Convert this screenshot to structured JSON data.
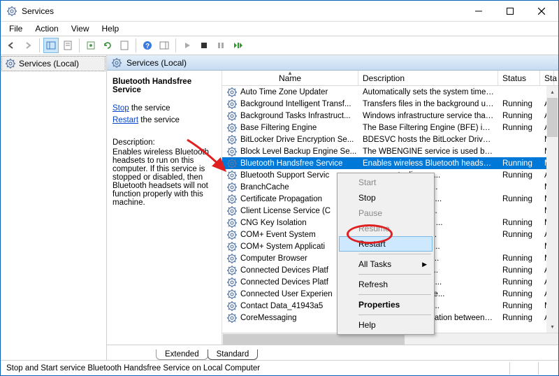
{
  "window": {
    "title": "Services"
  },
  "menu": {
    "file": "File",
    "action": "Action",
    "view": "View",
    "help": "Help"
  },
  "tree": {
    "root": "Services (Local)"
  },
  "header": {
    "label": "Services (Local)"
  },
  "detail": {
    "title": "Bluetooth Handsfree Service",
    "stop": "Stop",
    "stop_suffix": " the service",
    "restart": "Restart",
    "restart_suffix": " the service",
    "desc_label": "Description:",
    "desc_text": "Enables wireless Bluetooth headsets to run on this computer. If this service is stopped or disabled, then Bluetooth headsets will not function properly with this machine."
  },
  "columns": {
    "name": "Name",
    "desc": "Description",
    "status": "Status",
    "startup": "Sta"
  },
  "rows": [
    {
      "name": "Auto Time Zone Updater",
      "desc": "Automatically sets the system time zone.",
      "status": "",
      "startup": ""
    },
    {
      "name": "Background Intelligent Transf...",
      "desc": "Transfers files in the background using i...",
      "status": "Running",
      "startup": "Au"
    },
    {
      "name": "Background Tasks Infrastruct...",
      "desc": "Windows infrastructure service that con...",
      "status": "Running",
      "startup": "Au"
    },
    {
      "name": "Base Filtering Engine",
      "desc": "The Base Filtering Engine (BFE) is a servi...",
      "status": "Running",
      "startup": "Au"
    },
    {
      "name": "BitLocker Drive Encryption Se...",
      "desc": "BDESVC hosts the BitLocker Drive Encry...",
      "status": "",
      "startup": "Ma"
    },
    {
      "name": "Block Level Backup Engine Se...",
      "desc": "The WBENGINE service is used by Wind...",
      "status": "",
      "startup": "Ma"
    },
    {
      "name": "Bluetooth Handsfree Service",
      "desc": "Enables wireless Bluetooth headsets to r...",
      "status": "Running",
      "startup": "Ma",
      "selected": true
    },
    {
      "name": "Bluetooth Support Servic",
      "desc": "ce supports discove...",
      "status": "Running",
      "startup": "Au"
    },
    {
      "name": "BranchCache",
      "desc": "network content fro...",
      "status": "",
      "startup": "Ma"
    },
    {
      "name": "Certificate Propagation",
      "desc": "ates and root certific...",
      "status": "Running",
      "startup": "Ma"
    },
    {
      "name": "Client License Service (C",
      "desc": "ure support for the ...",
      "status": "",
      "startup": "Ma"
    },
    {
      "name": "CNG Key Isolation",
      "desc": "on service is hosted ...",
      "status": "Running",
      "startup": "Ma"
    },
    {
      "name": "COM+ Event System",
      "desc": "ent Notification Ser...",
      "status": "Running",
      "startup": "Au"
    },
    {
      "name": "COM+ System Applicati",
      "desc": "guration and trackin...",
      "status": "",
      "startup": "Ma"
    },
    {
      "name": "Computer Browser",
      "desc": "ed list of computers...",
      "status": "Running",
      "startup": "Ma"
    },
    {
      "name": "Connected Devices Platf",
      "desc": "for Connected Devi...",
      "status": "Running",
      "startup": "Au"
    },
    {
      "name": "Connected Devices Platf",
      "desc": "used for Connected ...",
      "status": "Running",
      "startup": "Au"
    },
    {
      "name": "Connected User Experien",
      "desc": "r Experiences and Te...",
      "status": "Running",
      "startup": "Au"
    },
    {
      "name": "Contact Data_41943a5",
      "desc": "a for fast contact se...",
      "status": "Running",
      "startup": "Ma"
    },
    {
      "name": "CoreMessaging",
      "desc": "Manages communication between syst...",
      "status": "Running",
      "startup": "Au"
    }
  ],
  "tabs": {
    "extended": "Extended",
    "standard": "Standard"
  },
  "statusbar": {
    "text": "Stop and Start service Bluetooth Handsfree Service on Local Computer"
  },
  "ctx": {
    "start": "Start",
    "stop": "Stop",
    "pause": "Pause",
    "resume": "Resume",
    "restart": "Restart",
    "alltasks": "All Tasks",
    "refresh": "Refresh",
    "properties": "Properties",
    "help": "Help"
  }
}
